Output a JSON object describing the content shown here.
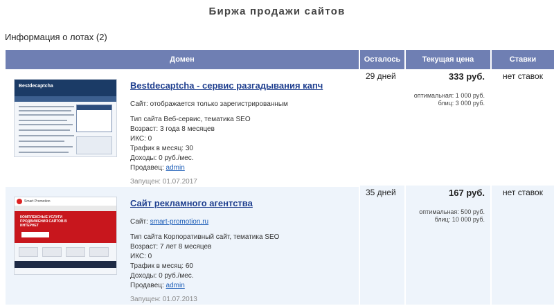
{
  "page": {
    "title": "Биржа продажи сайтов",
    "lots_info": "Информация о лотах (2)"
  },
  "table": {
    "headers": {
      "domain": "Домен",
      "remaining": "Осталось",
      "current_price": "Текущая цена",
      "bids": "Ставки"
    },
    "rows": [
      {
        "name": "Bestdecaptcha - сервис разгадывания капч",
        "site_label": "Сайт:",
        "site_value": "отображается только зарегистрированным",
        "site_value_is_link": false,
        "type": "Тип сайта Веб-сервис, тематика SEO",
        "age": "Возраст: 3 года 8 месяцев",
        "iks": "ИКС: 0",
        "traffic": "Трафик в месяц: 30",
        "income": "Доходы: 0 руб./мес.",
        "seller_label": "Продавец:",
        "seller": "admin",
        "launched": "Запущен: 01.07.2017",
        "days_left": "29 дней",
        "price": "333 руб.",
        "optimal": "оптимальная: 1 000 руб.",
        "blitz": "блиц: 3 000 руб.",
        "bids": "нет ставок",
        "thumb_logo": "Bestdecaptcha"
      },
      {
        "name": "Сайт рекламного агентства",
        "site_label": "Сайт:",
        "site_value": "smart-promotion.ru",
        "site_value_is_link": true,
        "type": "Тип сайта Корпоративный сайт, тематика SEO",
        "age": "Возраст: 7 лет 8 месяцев",
        "iks": "ИКС: 0",
        "traffic": "Трафик в месяц: 60",
        "income": "Доходы: 0 руб./мес.",
        "seller_label": "Продавец:",
        "seller": "admin",
        "launched": "Запущен: 01.07.2013",
        "days_left": "35 дней",
        "price": "167 руб.",
        "optimal": "оптимальная: 500 руб.",
        "blitz": "блиц: 10 000 руб.",
        "bids": "нет ставок",
        "thumb_logo": "Smart Promotion",
        "thumb_hero": "КОМПЛЕКСНЫЕ УСЛУГИ ПРОДВИЖЕНИЯ САЙТОВ В ИНТЕРНЕТ"
      }
    ]
  },
  "colors": {
    "header_bg": "#6f7fb3",
    "link": "#1f3f8f",
    "row_alt_bg": "#eef4fb"
  }
}
